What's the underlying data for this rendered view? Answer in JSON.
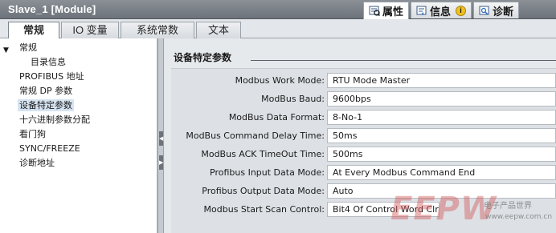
{
  "window": {
    "title": "Slave_1 [Module]"
  },
  "inspector_tabs": [
    {
      "label": "属性",
      "icon": "properties-icon",
      "active": true
    },
    {
      "label": "信息",
      "icon": "info-icon",
      "badge": "i",
      "active": false
    },
    {
      "label": "诊断",
      "icon": "diagnostics-icon",
      "active": false
    }
  ],
  "main_tabs": [
    {
      "label": "常规",
      "active": true
    },
    {
      "label": "IO 变量",
      "active": false
    },
    {
      "label": "系统常数",
      "active": false
    },
    {
      "label": "文本",
      "active": false
    }
  ],
  "nav": {
    "items": [
      {
        "label": "常规",
        "expanded": true
      },
      {
        "label": "目录信息"
      },
      {
        "label": "PROFIBUS 地址"
      },
      {
        "label": "常规 DP 参数"
      },
      {
        "label": "设备特定参数",
        "selected": true
      },
      {
        "label": "十六进制参数分配"
      },
      {
        "label": "看门狗"
      },
      {
        "label": "SYNC/FREEZE"
      },
      {
        "label": "诊断地址"
      }
    ]
  },
  "section": {
    "title": "设备特定参数"
  },
  "params": [
    {
      "label": "Modbus Work Mode:",
      "value": "RTU Mode Master"
    },
    {
      "label": "ModBus Baud:",
      "value": "9600bps"
    },
    {
      "label": "ModBus Data Format:",
      "value": "8-No-1"
    },
    {
      "label": "ModBus Command Delay Time:",
      "value": "50ms"
    },
    {
      "label": "ModBus ACK TimeOut Time:",
      "value": "500ms"
    },
    {
      "label": "Profibus Input Data Mode:",
      "value": "At Every Modbus Command End"
    },
    {
      "label": "Profibus Output Data Mode:",
      "value": "Auto"
    },
    {
      "label": "Modbus Start Scan Control:",
      "value": "Bit4 Of Control Word Clr 0"
    }
  ],
  "watermark": {
    "logo": "EEPW",
    "text_cn": "电子产品世界",
    "url": "www.eepw.com.cn"
  },
  "colors": {
    "titlebar": "#7a8087",
    "selection": "#d6e4f2",
    "content_bg": "#e6e9ec"
  }
}
